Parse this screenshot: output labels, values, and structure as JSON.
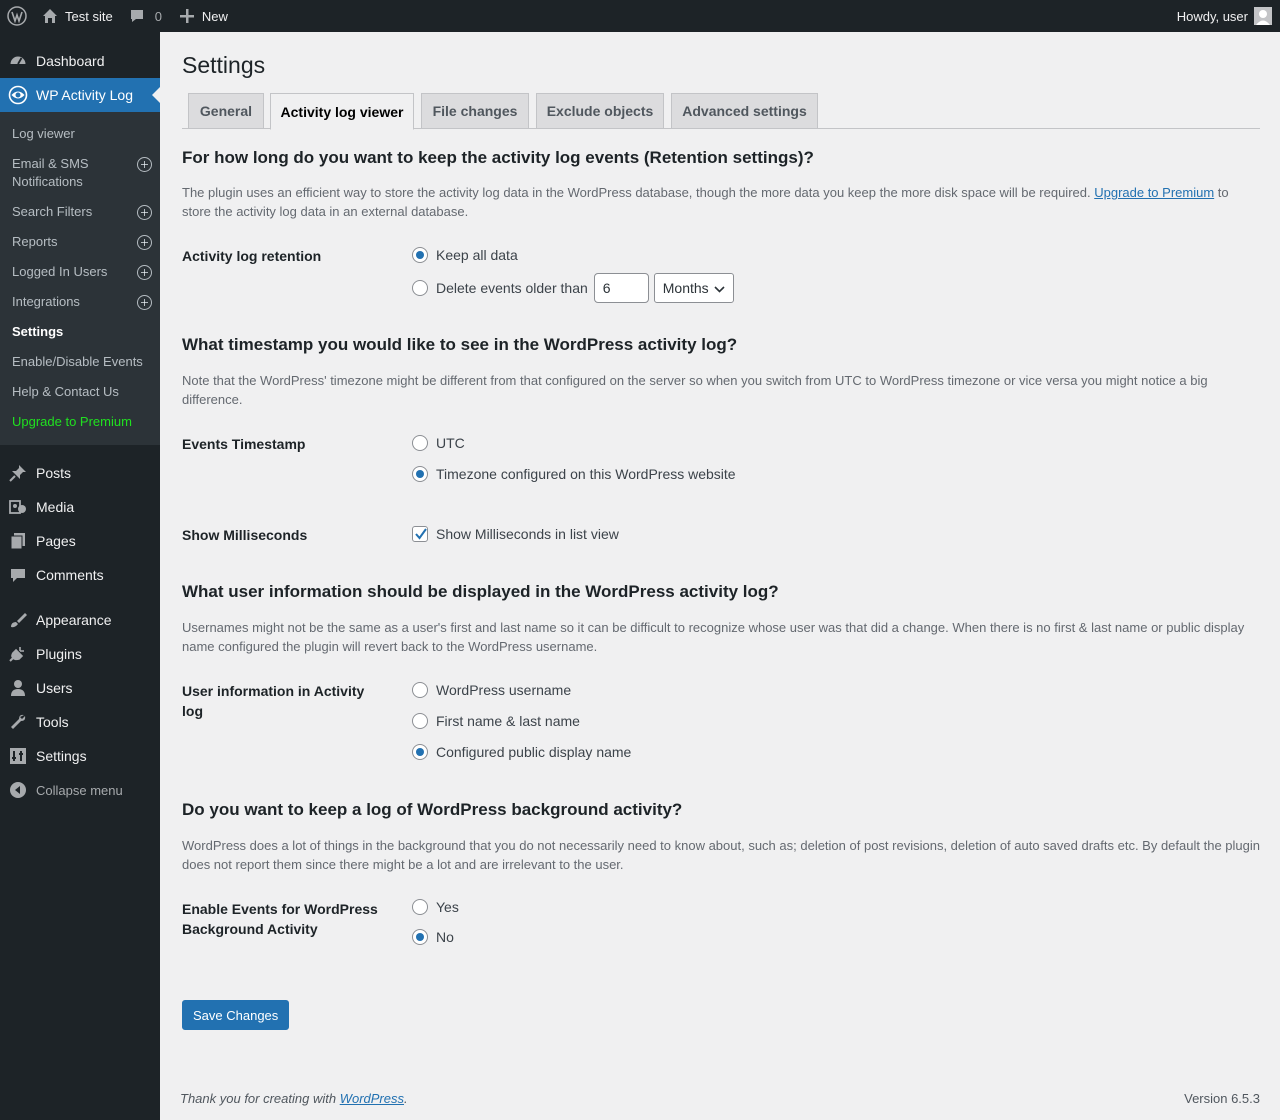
{
  "adminbar": {
    "site_name": "Test site",
    "comments_count": "0",
    "new_label": "New",
    "howdy": "Howdy, user"
  },
  "sidebar": {
    "dashboard": "Dashboard",
    "plugin_menu": "WP Activity Log",
    "submenu": [
      {
        "label": "Log viewer",
        "plus": false
      },
      {
        "label": "Email & SMS Notifications",
        "plus": true
      },
      {
        "label": "Search Filters",
        "plus": true
      },
      {
        "label": "Reports",
        "plus": true
      },
      {
        "label": "Logged In Users",
        "plus": true
      },
      {
        "label": "Integrations",
        "plus": true
      },
      {
        "label": "Settings",
        "plus": false
      },
      {
        "label": "Enable/Disable Events",
        "plus": false
      },
      {
        "label": "Help & Contact Us",
        "plus": false
      },
      {
        "label": "Upgrade to Premium",
        "plus": false
      }
    ],
    "posts": "Posts",
    "media": "Media",
    "pages": "Pages",
    "comments": "Comments",
    "appearance": "Appearance",
    "plugins": "Plugins",
    "users": "Users",
    "tools": "Tools",
    "settings": "Settings",
    "collapse": "Collapse menu"
  },
  "page": {
    "title": "Settings",
    "tabs": [
      "General",
      "Activity log viewer",
      "File changes",
      "Exclude objects",
      "Advanced settings"
    ],
    "active_tab": "Activity log viewer"
  },
  "retention": {
    "heading": "For how long do you want to keep the activity log events (Retention settings)?",
    "desc_before": "The plugin uses an efficient way to store the activity log data in the WordPress database, though the more data you keep the more disk space will be required. ",
    "desc_link": "Upgrade to Premium",
    "desc_after": " to store the activity log data in an external database.",
    "label": "Activity log retention",
    "opt_keep": "Keep all data",
    "opt_delete": "Delete events older than",
    "delete_value": "6",
    "delete_unit": "Months",
    "selected": "keep"
  },
  "timestamp": {
    "heading": "What timestamp you would like to see in the WordPress activity log?",
    "desc": "Note that the WordPress' timezone might be different from that configured on the server so when you switch from UTC to WordPress timezone or vice versa you might notice a big difference.",
    "label": "Events Timestamp",
    "opt_utc": "UTC",
    "opt_tz": "Timezone configured on this WordPress website",
    "selected": "tz"
  },
  "milliseconds": {
    "label": "Show Milliseconds",
    "opt": "Show Milliseconds in list view",
    "checked": true
  },
  "userinfo": {
    "heading": "What user information should be displayed in the WordPress activity log?",
    "desc": "Usernames might not be the same as a user's first and last name so it can be difficult to recognize whose user was that did a change. When there is no first & last name or public display name configured the plugin will revert back to the WordPress username.",
    "label": "User information in Activity log",
    "opt_username": "WordPress username",
    "opt_name": "First name & last name",
    "opt_display": "Configured public display name",
    "selected": "display"
  },
  "background": {
    "heading": "Do you want to keep a log of WordPress background activity?",
    "desc": "WordPress does a lot of things in the background that you do not necessarily need to know about, such as; deletion of post revisions, deletion of auto saved drafts etc. By default the plugin does not report them since there might be a lot and are irrelevant to the user.",
    "label": "Enable Events for WordPress Background Activity",
    "opt_yes": "Yes",
    "opt_no": "No",
    "selected": "no"
  },
  "save_label": "Save Changes",
  "footer": {
    "thanks_before": "Thank you for creating with ",
    "thanks_link": "WordPress",
    "thanks_after": ".",
    "version": "Version 6.5.3"
  },
  "colors": {
    "accent": "#2271b1",
    "sidebar_bg": "#1d2327",
    "premium_green": "#20e020"
  }
}
